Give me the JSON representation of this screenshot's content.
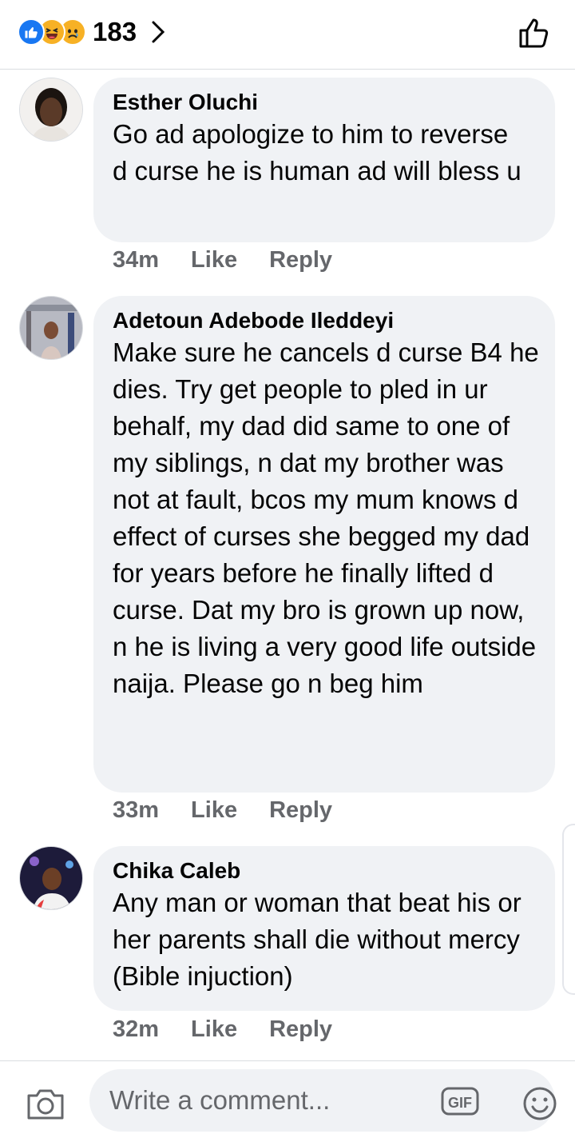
{
  "header": {
    "reaction_count": "183",
    "reactions": [
      "like-icon",
      "haha-icon",
      "sad-icon"
    ]
  },
  "comments": [
    {
      "author": "Esther Oluchi",
      "text": "Go ad apologize to him to reverse d curse he is human ad will bless u",
      "time": "34m",
      "like_label": "Like",
      "reply_label": "Reply"
    },
    {
      "author": "Adetoun Adebode Ileddeyi",
      "text": "Make sure he cancels d curse B4 he dies. Try get people to pled in ur behalf, my dad did same to one of my siblings, n dat my brother was not at fault, bcos my mum knows d effect of curses she begged my dad for years before he finally lifted d curse. Dat my bro is grown up now, n he is living a very good life outside naija. Please go n beg him",
      "time": "33m",
      "like_label": "Like",
      "reply_label": "Reply"
    },
    {
      "author": "Chika Caleb",
      "text": "Any man or woman that beat his or her parents shall die without mercy (Bible injuction)",
      "time": "32m",
      "like_label": "Like",
      "reply_label": "Reply"
    }
  ],
  "composer": {
    "placeholder": "Write a comment...",
    "gif_label": "GIF"
  },
  "colors": {
    "like_blue": "#1877f2",
    "reaction_yellow": "#f7b125",
    "bubble_bg": "#f0f2f5",
    "meta_gray": "#65676b"
  }
}
